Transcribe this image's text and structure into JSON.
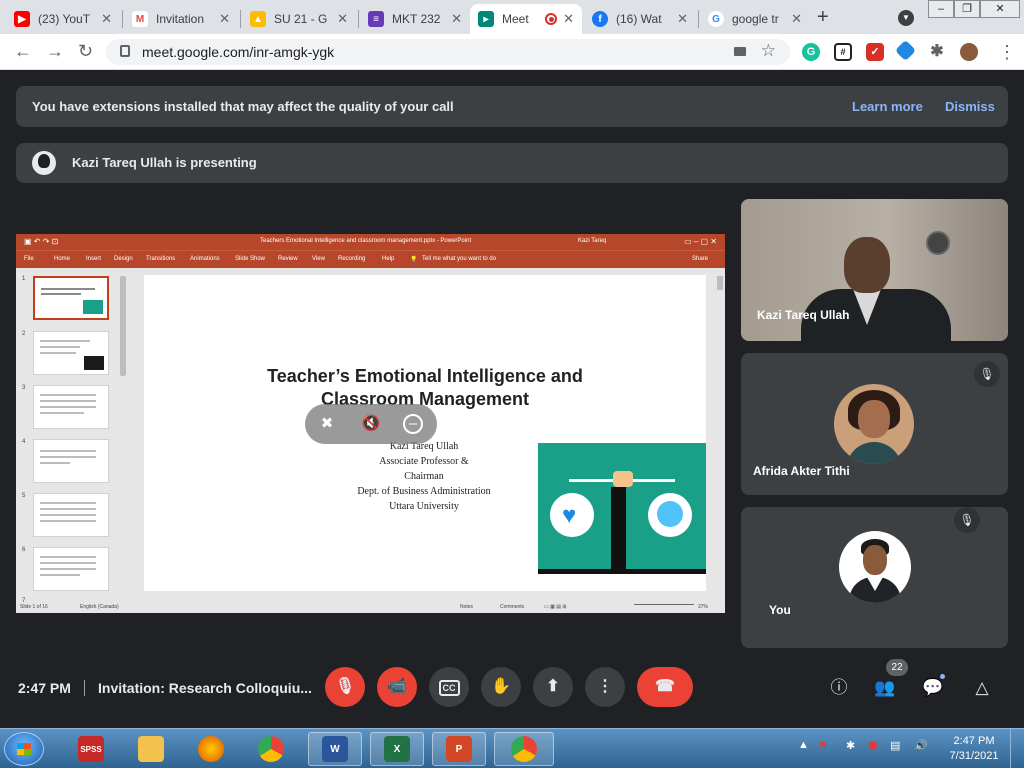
{
  "browser": {
    "tabs": [
      {
        "title": "(23) YouT",
        "favicon": "youtube-icon",
        "color": "#ff0000"
      },
      {
        "title": "Invitation",
        "favicon": "gmail-icon",
        "color": "#ea4335"
      },
      {
        "title": "SU 21 - G",
        "favicon": "google-drive-icon",
        "color": "#fbbc04"
      },
      {
        "title": "MKT 232",
        "favicon": "google-forms-icon",
        "color": "#673ab7"
      },
      {
        "title": "Meet",
        "favicon": "google-meet-icon",
        "color": "#00897b",
        "active": true
      },
      {
        "title": "(16) Wat",
        "favicon": "facebook-icon",
        "color": "#1877f2"
      },
      {
        "title": "google tr",
        "favicon": "google-icon",
        "color": "#4285f4"
      }
    ],
    "url": "meet.google.com/inr-amgk-ygk"
  },
  "notices": {
    "extensions_msg": "You have extensions installed that may affect the quality of your call",
    "learn_more": "Learn more",
    "dismiss": "Dismiss",
    "presenting_msg": "Kazi Tareq Ullah is presenting"
  },
  "powerpoint": {
    "window_title": "Teachers Emotional Intelligence and classroom management.pptx  -  PowerPoint",
    "user": "Kazi Tareq",
    "ribbon_tabs": [
      "File",
      "Home",
      "Insert",
      "Design",
      "Transitions",
      "Animations",
      "Slide Show",
      "Review",
      "View",
      "Recording",
      "Help"
    ],
    "tell_me": "Tell me what you want to do",
    "share": "Share",
    "thumb_numbers": [
      "1",
      "2",
      "3",
      "4",
      "5",
      "6",
      "7"
    ],
    "status_left": "Slide 1 of 16",
    "status_lang": "English (Canada)",
    "status_notes": "Notes",
    "status_comments": "Comments",
    "zoom": "37%",
    "slide": {
      "title": "Teacher’s Emotional Intelligence and Classroom Management",
      "lines": [
        "Kazi Tareq Ullah",
        "Associate Professor &",
        "Chairman",
        "Dept. of Business Administration",
        "Uttara University"
      ]
    }
  },
  "participants": [
    {
      "name": "Kazi Tareq Ullah"
    },
    {
      "name": "Afrida Akter Tithi",
      "muted": true
    },
    {
      "name": "You",
      "muted": true
    }
  ],
  "controls": {
    "time": "2:47 PM",
    "meeting_title": "Invitation: Research Colloquiu...",
    "cc_label": "CC",
    "participant_count": "22"
  },
  "taskbar": {
    "apps": [
      "windows-start",
      "spss",
      "file-explorer",
      "firefox",
      "chrome",
      "word",
      "excel",
      "powerpoint-presenter",
      "chrome-active"
    ],
    "spss_label": "SPSS",
    "clock_time": "2:47 PM",
    "clock_date": "7/31/2021"
  }
}
